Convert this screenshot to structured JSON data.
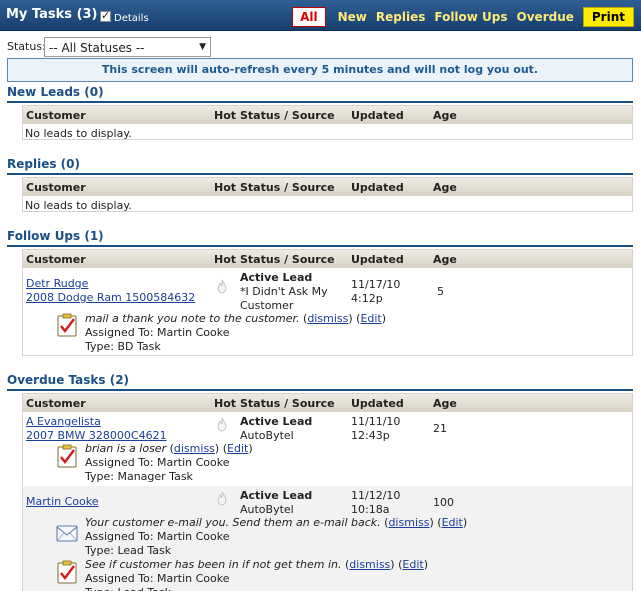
{
  "header": {
    "title": "My Tasks",
    "count": "(3)",
    "details_label": "Details",
    "nav": {
      "all": "All",
      "new": "New",
      "replies": "Replies",
      "follow_ups": "Follow Ups",
      "overdue": "Overdue",
      "print": "Print"
    }
  },
  "filter": {
    "label": "Status:",
    "selected": "-- All Statuses --"
  },
  "notice": "This screen will auto-refresh every 5 minutes and will not log you out.",
  "columns": {
    "customer": "Customer",
    "hot": "Hot",
    "status": "Status / Source",
    "updated": "Updated",
    "age": "Age"
  },
  "sections": {
    "new_leads": {
      "title": "New Leads (0)",
      "empty": "No leads to display."
    },
    "replies": {
      "title": "Replies (0)",
      "empty": "No leads to display."
    },
    "follow_ups": {
      "title": "Follow Ups (1)",
      "rows": [
        {
          "name": "Detr Rudge",
          "vehicle": "2008 Dodge Ram 1500584632",
          "status": "Active Lead",
          "source_line1": "*I Didn't Ask My",
          "source_line2": "Customer",
          "updated_date": "11/17/10",
          "updated_time": "4:12p",
          "age": "5",
          "tasks": [
            {
              "text": "mail a thank you note to the customer.",
              "dismiss": "dismiss",
              "edit": "Edit",
              "assigned": "Assigned To: Martin Cooke",
              "type": "Type: BD Task"
            }
          ]
        }
      ]
    },
    "overdue": {
      "title": "Overdue Tasks (2)",
      "rows": [
        {
          "name": "A Evangelista",
          "vehicle": "2007 BMW 328000C4621",
          "status": "Active Lead",
          "source": "AutoBytel",
          "updated_date": "11/11/10",
          "updated_time": "12:43p",
          "age": "21",
          "tasks": [
            {
              "text": "brian is a loser",
              "dismiss": "dismiss",
              "edit": "Edit",
              "assigned": "Assigned To: Martin Cooke",
              "type": "Type: Manager Task"
            }
          ]
        },
        {
          "name": "Martin Cooke",
          "status": "Active Lead",
          "source": "AutoBytel",
          "updated_date": "11/12/10",
          "updated_time": "10:18a",
          "age": "100",
          "tasks": [
            {
              "text": "Your customer e-mail you. Send them an e-mail back.",
              "dismiss": "dismiss",
              "edit": "Edit",
              "assigned": "Assigned To: Martin Cooke",
              "type": "Type: Lead Task"
            },
            {
              "text": "See if customer has been in if not get them in.",
              "dismiss": "dismiss",
              "edit": "Edit",
              "assigned": "Assigned To: Martin Cooke",
              "type": "Type: Lead Task"
            }
          ]
        }
      ]
    }
  },
  "colors": {
    "header_bg": "#1f4a7c",
    "section_title": "#1a4f87",
    "link": "#1b3e99",
    "nav_link": "#ffe97a",
    "print_bg": "#ffec00",
    "all_text": "#dd0000"
  }
}
